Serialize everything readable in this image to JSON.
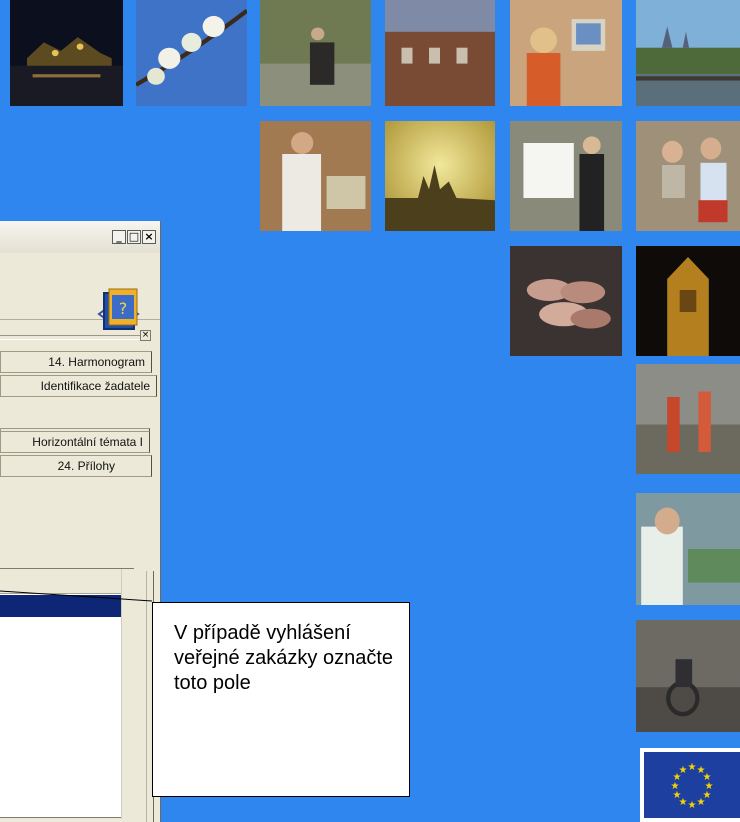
{
  "window": {
    "title_buttons": {
      "minimize": "_",
      "maximize": "□",
      "close": "×"
    },
    "panel_close": "×",
    "tabs": [
      {
        "label": "14. Harmonogram"
      },
      {
        "label": "Identifikace žadatele"
      },
      {
        "label": "Horizontální témata I"
      },
      {
        "label": "24. Přílohy"
      }
    ],
    "icons": {
      "hand": "hand-pointer-icon",
      "help": "help-book-icon"
    }
  },
  "callout": {
    "text": "V případě vyhlášení veřejné zakázky označte toto pole"
  },
  "photos": [
    "night-castle-photo",
    "blossom-branch-photo",
    "stroller-park-photo",
    "historic-building-photo",
    "office-computer-photo",
    "prague-castle-river-photo",
    "lab-worker-photo",
    "sunset-castle-photo",
    "presentation-photo",
    "students-photo",
    "coins-photo",
    "powder-tower-photo",
    "construction-workers-photo",
    "dentist-photo",
    "wheelchair-street-photo"
  ],
  "eu_flag": "eu-flag-icon",
  "colors": {
    "background": "#2f86ee",
    "selection": "#0d2675"
  }
}
